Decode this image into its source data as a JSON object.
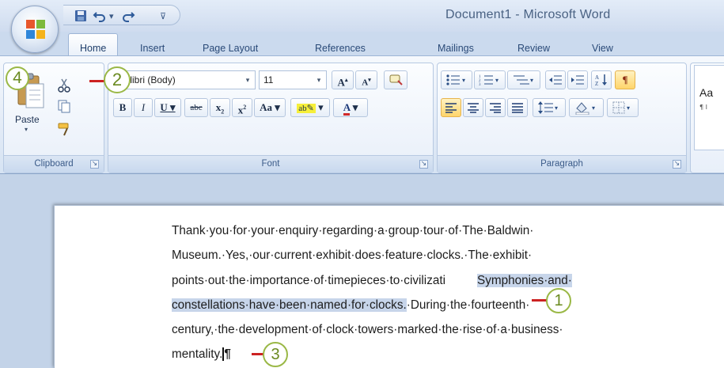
{
  "window": {
    "title": "Document1 - Microsoft Word"
  },
  "tabs": [
    "Home",
    "Insert",
    "Page Layout",
    "References",
    "Mailings",
    "Review",
    "View"
  ],
  "clipboard": {
    "paste_label": "Paste",
    "group_label": "Clipboard"
  },
  "font": {
    "family": "Calibri (Body)",
    "size": "11",
    "group_label": "Font"
  },
  "paragraph": {
    "group_label": "Paragraph"
  },
  "styles": {
    "preview": "Aa",
    "sub": "¶ I"
  },
  "callouts": [
    "1",
    "2",
    "3",
    "4"
  ],
  "document": {
    "lines": [
      "Thank·you·for·your·enquiry·regarding·a·group·tour·of·The·Baldwin·",
      "Museum.·Yes,·our·current·exhibit·does·feature·clocks.·The·exhibit·",
      "points·out·the·importance·of·timepieces·to·civilizati",
      "Symphonies·and·",
      "constellations·have·been·named·for·clocks.",
      "·During·the·fourteenth·",
      "century,·the·development·of·clock·towers·marked·the·rise·of·a·business·",
      "mentality."
    ]
  },
  "colors": {
    "ribbon_blue": "#dbe6f4",
    "callout_green": "#9ab846",
    "callout_line": "#cc2222",
    "selection": "#c7d5ea"
  }
}
